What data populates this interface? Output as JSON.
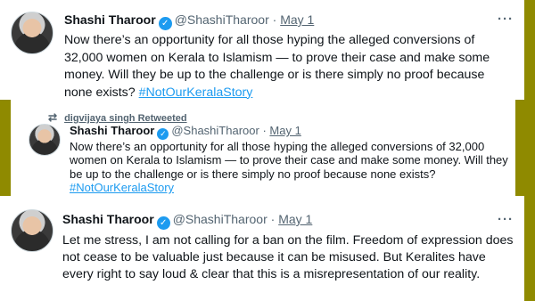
{
  "colors": {
    "accent": "#1d9bf0",
    "frame": "#8f8a00",
    "text": "#0f1419",
    "muted": "#536471"
  },
  "tweets": [
    {
      "name": "Shashi Tharoor",
      "handle": "@ShashiTharoor",
      "separator": "·",
      "date": "May 1",
      "more": "···",
      "text": "Now there’s an opportunity for all those hyping the alleged conversions of 32,000 women on Kerala to Islamism — to prove their case and make some money. Will they be up to the challenge or is there simply no proof because none exists?",
      "hashtag": "#NotOurKeralaStory",
      "avatar_icon": "avatar"
    },
    {
      "retweet_icon": "retweet-icon",
      "retweeted_by": "digvijaya singh Retweeted",
      "name": "Shashi Tharoor",
      "handle": "@ShashiTharoor",
      "separator": "·",
      "date": "May 1",
      "text": "Now there’s an opportunity for all those hyping the alleged conversions of 32,000 women on Kerala to Islamism — to prove their case and make some money. Will they be up to the challenge or is there simply no proof because none exists?",
      "hashtag": "#NotOurKeralaStory",
      "avatar_icon": "avatar"
    },
    {
      "name": "Shashi Tharoor",
      "handle": "@ShashiTharoor",
      "separator": "·",
      "date": "May 1",
      "more": "···",
      "text": "Let me stress, I am not calling for a ban on the film. Freedom of expression does not cease to be valuable just because it can be misused. But Keralites have every right to say loud & clear that this is a misrepresentation of our reality.",
      "avatar_icon": "avatar"
    }
  ]
}
